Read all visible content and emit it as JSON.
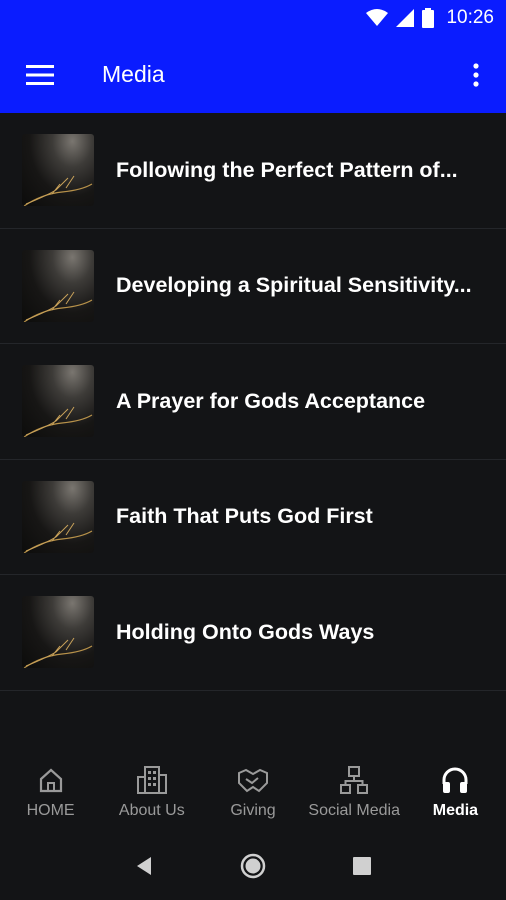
{
  "status_bar": {
    "time": "10:26",
    "icons": [
      "wifi-icon",
      "signal-icon",
      "battery-icon"
    ]
  },
  "app_bar": {
    "title": "Media",
    "menu_icon": "hamburger-menu-icon",
    "overflow_icon": "more-vert-icon",
    "color": "#0a1cff"
  },
  "media": {
    "items": [
      {
        "title": "Following the Perfect Pattern of..."
      },
      {
        "title": "Developing a Spiritual Sensitivity..."
      },
      {
        "title": "A Prayer for Gods Acceptance"
      },
      {
        "title": "Faith That Puts God First"
      },
      {
        "title": "Holding Onto Gods Ways"
      }
    ]
  },
  "bottom_nav": {
    "items": [
      {
        "label": "HOME",
        "icon": "home-icon",
        "active": false
      },
      {
        "label": "About Us",
        "icon": "building-icon",
        "active": false
      },
      {
        "label": "Giving",
        "icon": "handshake-icon",
        "active": false
      },
      {
        "label": "Social Media",
        "icon": "network-icon",
        "active": false
      },
      {
        "label": "Media",
        "icon": "headphones-icon",
        "active": true
      }
    ]
  },
  "system_nav": [
    "back-icon",
    "home-circle-icon",
    "recents-icon"
  ]
}
